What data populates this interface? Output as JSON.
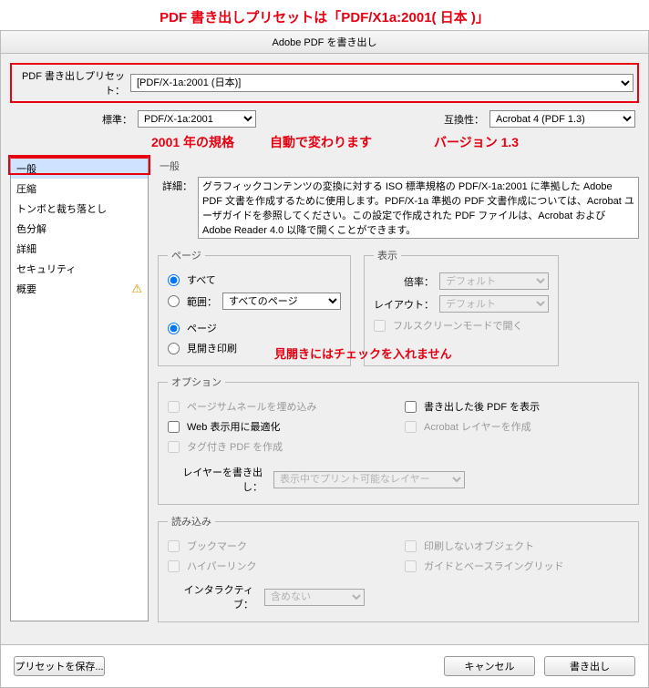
{
  "annotation": {
    "top": "PDF 書き出しプリセットは「PDF/X1a:2001( 日本 )」",
    "std": "2001 年の規格",
    "auto": "自動で変わります",
    "ver": "バージョン 1.3",
    "spread": "見開きにはチェックを入れません"
  },
  "window": {
    "title": "Adobe PDF を書き出し"
  },
  "preset": {
    "label": "PDF 書き出しプリセット：",
    "value": "[PDF/X-1a:2001 (日本)]"
  },
  "standard": {
    "label": "標準：",
    "value": "PDF/X-1a:2001"
  },
  "compat": {
    "label": "互換性：",
    "value": "Acrobat 4 (PDF 1.3)"
  },
  "sidebar": {
    "items": [
      {
        "label": "一般",
        "selected": true
      },
      {
        "label": "圧縮"
      },
      {
        "label": "トンボと裁ち落とし"
      },
      {
        "label": "色分解"
      },
      {
        "label": "詳細"
      },
      {
        "label": "セキュリティ"
      },
      {
        "label": "概要",
        "warn": true
      }
    ]
  },
  "general": {
    "heading": "一般",
    "desc_label": "詳細：",
    "desc": "グラフィックコンテンツの変換に対する ISO 標準規格の PDF/X-1a:2001 に準拠した Adobe PDF 文書を作成するために使用します。PDF/X-1a 準拠の PDF 文書作成については、Acrobat ユーザガイドを参照してください。この設定で作成された PDF ファイルは、Acrobat および Adobe Reader 4.0 以降で開くことができます。"
  },
  "pages": {
    "legend": "ページ",
    "all": "すべて",
    "range_label": "範囲：",
    "range_value": "すべてのページ",
    "pages_radio": "ページ",
    "spread_radio": "見開き印刷"
  },
  "display": {
    "legend": "表示",
    "zoom_label": "倍率：",
    "zoom_value": "デフォルト",
    "layout_label": "レイアウト：",
    "layout_value": "デフォルト",
    "fullscreen": "フルスクリーンモードで開く"
  },
  "options": {
    "legend": "オプション",
    "thumb": "ページサムネールを埋め込み",
    "viewpdf": "書き出した後 PDF を表示",
    "web": "Web 表示用に最適化",
    "acrobat_layer": "Acrobat レイヤーを作成",
    "tagged": "タグ付き PDF を作成",
    "layer_export_label": "レイヤーを書き出し：",
    "layer_export_value": "表示中でプリント可能なレイヤー"
  },
  "include": {
    "legend": "読み込み",
    "bookmark": "ブックマーク",
    "noprint": "印刷しないオブジェクト",
    "hyperlink": "ハイパーリンク",
    "guides": "ガイドとベースライングリッド",
    "interactive_label": "インタラクティブ：",
    "interactive_value": "含めない"
  },
  "buttons": {
    "save_preset": "プリセットを保存...",
    "cancel": "キャンセル",
    "export": "書き出し"
  }
}
